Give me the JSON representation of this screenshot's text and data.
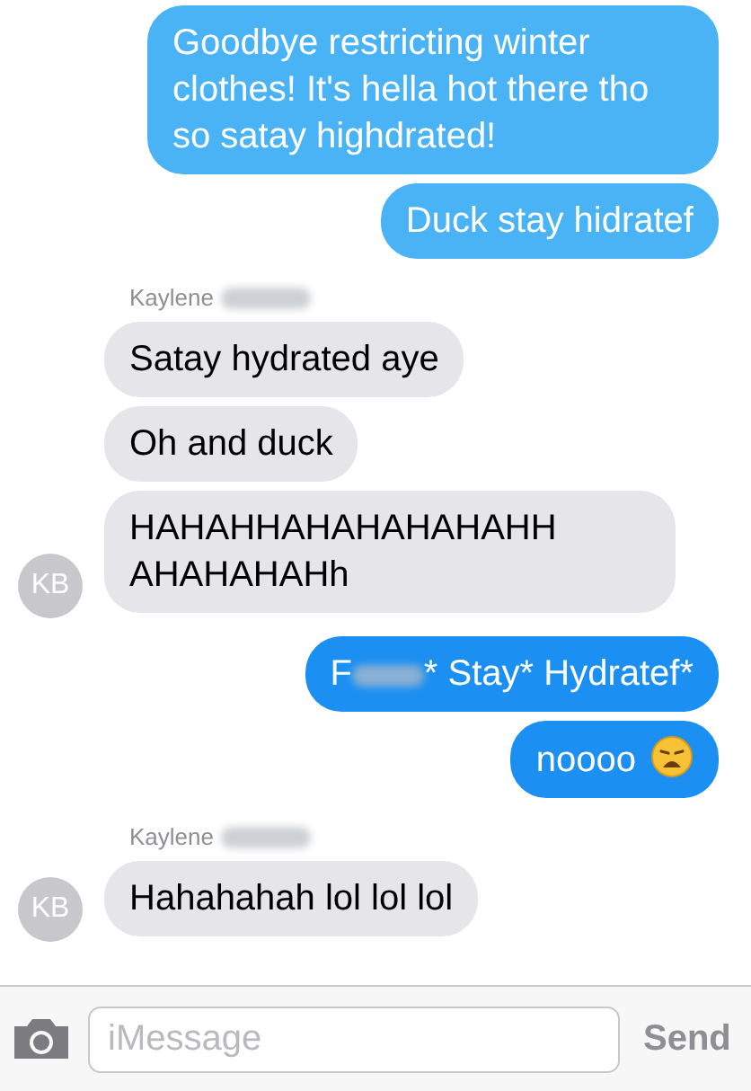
{
  "items": [
    {
      "kind": "sent",
      "color": "#4ab3f6",
      "text": "Goodbye restricting winter clothes! It's hella hot there tho so satay highdrated!"
    },
    {
      "kind": "sent",
      "color": "#4ab3f6",
      "text": "Duck stay hidratef"
    },
    {
      "kind": "sender",
      "name": "Kaylene",
      "redacted": true
    },
    {
      "kind": "received",
      "text": "Satay hydrated aye"
    },
    {
      "kind": "received",
      "text": "Oh and duck"
    },
    {
      "kind": "received",
      "text": "HAHAHHAHAHAHAHAHH AHAHAHAHh",
      "avatar": "KB"
    },
    {
      "kind": "sent",
      "color": "#1b8ff2",
      "prefix": "F",
      "redacted": true,
      "text": "* Stay* Hydratef*"
    },
    {
      "kind": "sent",
      "color": "#1b8ff2",
      "text": "noooo",
      "emoji": true
    },
    {
      "kind": "sender",
      "name": "Kaylene",
      "redacted": true
    },
    {
      "kind": "received",
      "text": "Hahahahah lol lol lol",
      "avatar": "KB"
    }
  ],
  "composer": {
    "placeholder": "iMessage",
    "send": "Send"
  }
}
